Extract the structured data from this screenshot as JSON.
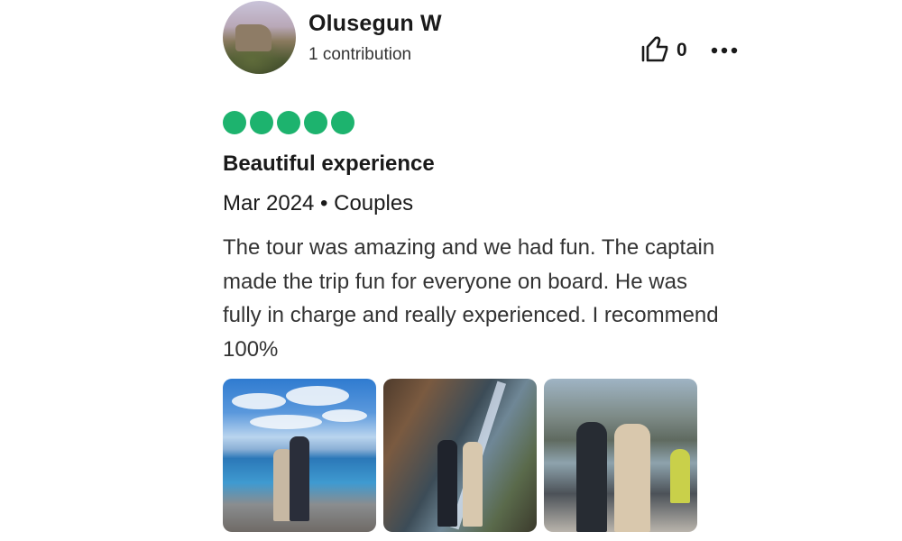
{
  "reviewer": {
    "name": "Olusegun W",
    "contributions": "1 contribution"
  },
  "actions": {
    "like_count": "0",
    "like_icon": "thumbs-up-icon",
    "more_icon": "more-options-icon"
  },
  "review": {
    "rating": 5,
    "rating_max": 5,
    "rating_color": "#1db36e",
    "title": "Beautiful experience",
    "meta": "Mar 2024 • Couples",
    "body": "The tour was amazing and we had fun. The captain made the trip fun for everyone on board. He was fully in charge and really experienced. I recommend 100%"
  }
}
